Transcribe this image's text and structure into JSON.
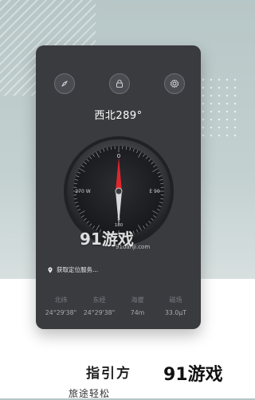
{
  "heading": "西北289°",
  "icons": {
    "left": "compass-needle-icon",
    "center": "lock-icon",
    "right": "gear-icon"
  },
  "compass": {
    "labels": {
      "north": "0",
      "west": "270 W",
      "east": "E 90",
      "south": "S",
      "south_degree": "180"
    },
    "heading_degrees": 289,
    "needle_color": "#e0262c"
  },
  "location_text": "获取定位服务...",
  "stats": [
    {
      "label": "北纬",
      "value": "24°29'38\""
    },
    {
      "label": "东经",
      "value": "24°29'38\""
    },
    {
      "label": "海拔",
      "value": "74m"
    },
    {
      "label": "磁场",
      "value": "33.0μT"
    }
  ],
  "watermark": {
    "text": "91游戏",
    "url": "91danji.com"
  },
  "bottom": {
    "title": "指引方",
    "subtitle": "旅途轻松",
    "brand": "91游戏"
  },
  "colors": {
    "panel": "#3a3b3f",
    "accent_red": "#e0262c"
  }
}
